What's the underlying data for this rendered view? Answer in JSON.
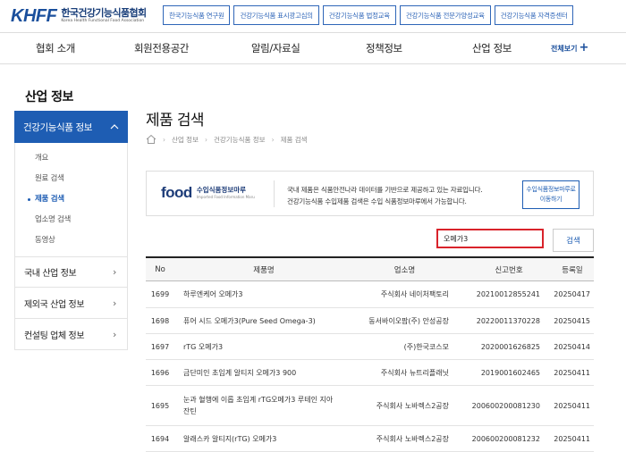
{
  "header": {
    "logo_mark": "KHFF",
    "logo_ko": "한국건강기능식품협회",
    "logo_en": "Korea Health Functional Food Association",
    "quick_links": [
      "한국기능식품 연구원",
      "건강기능식품 표시광고심의",
      "건강기능식품 법정교육",
      "건강기능식품 전문가양성교육",
      "건강기능식품 자격증센터"
    ]
  },
  "gnb": {
    "items": [
      "협회 소개",
      "회원전용공간",
      "알림/자료실",
      "정책정보",
      "산업 정보"
    ],
    "all_label": "전체보기"
  },
  "sidebar": {
    "title": "산업 정보",
    "active_group": "건강기능식품 정보",
    "sub_items": [
      "개요",
      "원료 검색",
      "제품 검색",
      "업소명 검색",
      "동영상"
    ],
    "active_sub_index": 2,
    "groups": [
      "국내 산업 정보",
      "제외국 산업 정보",
      "컨설팅 업체 정보"
    ]
  },
  "main": {
    "title": "제품 검색",
    "breadcrumb": [
      "산업 정보",
      "건강기능식품 정보",
      "제품 검색"
    ],
    "info": {
      "logo_food": "food",
      "logo_ko": "수입식품정보마루",
      "logo_en": "Imported Food Information Maru",
      "line1": "국내 제품은 식품안전나라 데이터를 기반으로 제공하고 있는 자료입니다.",
      "line2": "건강기능식품 수입제품 검색은 수입 식품정보마루에서 가능합니다.",
      "button_line1": "수입식품정보마루로",
      "button_line2": "이동하기"
    },
    "search": {
      "value": "오메가3",
      "button": "검색"
    },
    "table": {
      "headers": [
        "No",
        "제품명",
        "업소명",
        "신고번호",
        "등록일"
      ],
      "rows": [
        {
          "no": "1699",
          "name": "하루엔케어 오메가3",
          "company": "주식회사 네이처팩토리",
          "reg": "20210012855241",
          "date": "20250417"
        },
        {
          "no": "1698",
          "name": "퓨어 시드 오메가3(Pure Seed Omega-3)",
          "company": "동서바이오팜(주) 안성공장",
          "reg": "20220011370228",
          "date": "20250415"
        },
        {
          "no": "1697",
          "name": "rTG 오메가3",
          "company": "(주)한국코스모",
          "reg": "2020001626825",
          "date": "20250414"
        },
        {
          "no": "1696",
          "name": "금단미인 초임계 알티지 오메가3 900",
          "company": "주식회사 뉴트리플래닛",
          "reg": "2019001602465",
          "date": "20250411"
        },
        {
          "no": "1695",
          "name": "눈과 혈행에 이롭 초임계 rTG오메가3 루테인 지아잔틴",
          "company": "주식회사 노바렉스2공장",
          "reg": "200600200081230",
          "date": "20250411"
        },
        {
          "no": "1694",
          "name": "알래스카 알티지(rTG) 오메가3",
          "company": "주식회사 노바렉스2공장",
          "reg": "200600200081232",
          "date": "20250411"
        }
      ]
    }
  },
  "colors": {
    "primary": "#1e5db3",
    "search_highlight": "#d9232b",
    "logo": "#1a4f9c"
  }
}
